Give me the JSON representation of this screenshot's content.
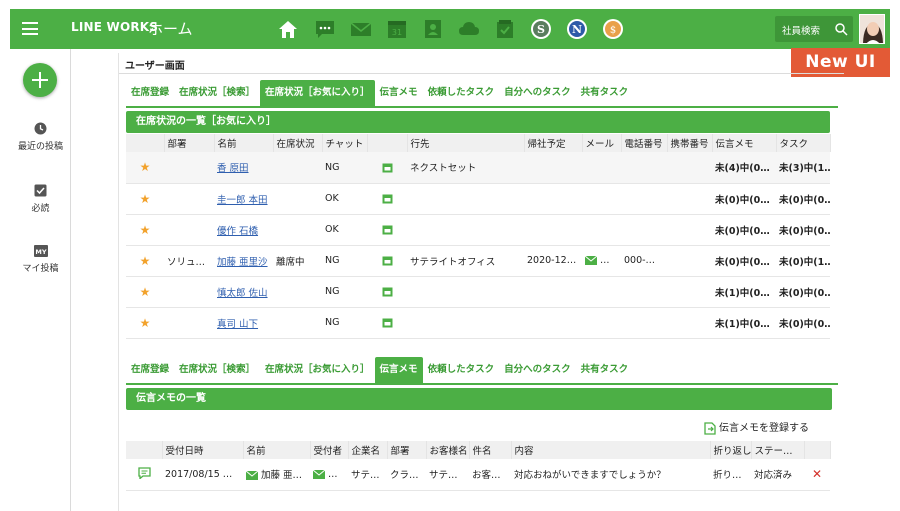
{
  "header": {
    "brand": "LINE WORKS",
    "title": "ホーム",
    "calendar_day": "31",
    "search_label": "社員検索",
    "services": [
      "home-icon",
      "chat-icon",
      "mail-icon",
      "calendar-icon",
      "contacts-icon",
      "drive-icon",
      "task-icon",
      "app-s-icon",
      "app-n-icon",
      "app-s2-icon"
    ],
    "color": "#4caf45"
  },
  "badge": {
    "label": "New UI",
    "color": "#e35a36"
  },
  "sidebar": {
    "items": [
      {
        "label": "最近の投稿",
        "icon": "clock-icon"
      },
      {
        "label": "必読",
        "icon": "check-square-icon"
      },
      {
        "label": "マイ投稿",
        "icon": "my-posts-icon",
        "icon_text": "MY"
      }
    ]
  },
  "panel": {
    "title": "ユーザー画面"
  },
  "tabs_top": [
    "在席登録",
    "在席状況［検索］",
    "在席状況［お気に入り］",
    "伝言メモ",
    "依頼したタスク",
    "自分へのタスク",
    "共有タスク"
  ],
  "tabs_bottom": [
    "在席登録",
    "在席状況［検索］",
    "在席状況［お気に入り］",
    "伝言メモ",
    "依頼したタスク",
    "自分へのタスク",
    "共有タスク"
  ],
  "attendance": {
    "section_title": "在席状況の一覧［お気に入り］",
    "columns": [
      "部署",
      "名前",
      "在席状況",
      "チャット",
      "",
      "行先",
      "帰社予定",
      "メール",
      "電話番号",
      "携帯番号",
      "伝言メモ",
      "タスク"
    ],
    "rows": [
      {
        "dept": "",
        "name": "香 原田",
        "status": "",
        "chat": "NG",
        "dest": "ネクストセット",
        "return": "",
        "mail": "",
        "phone": "",
        "mobile": "",
        "memo": "未(4)中(0…",
        "task": "未(3)中(1…"
      },
      {
        "dept": "",
        "name": "圭一郎 本田",
        "status": "",
        "chat": "OK",
        "dest": "",
        "return": "",
        "mail": "",
        "phone": "",
        "mobile": "",
        "memo": "未(0)中(0…",
        "task": "未(0)中(0…"
      },
      {
        "dept": "",
        "name": "優作 石橋",
        "status": "",
        "chat": "OK",
        "dest": "",
        "return": "",
        "mail": "",
        "phone": "",
        "mobile": "",
        "memo": "未(0)中(0…",
        "task": "未(0)中(0…"
      },
      {
        "dept": "ソリュ…",
        "name": "加藤 亜里沙",
        "status": "離席中",
        "chat": "NG",
        "dest": "サテライトオフィス",
        "return": "2020-12…",
        "mail": "…",
        "phone": "000-…",
        "mobile": "",
        "memo": "未(0)中(0…",
        "task": "未(0)中(1…"
      },
      {
        "dept": "",
        "name": "慎太郎 佐山",
        "status": "",
        "chat": "NG",
        "dest": "",
        "return": "",
        "mail": "",
        "phone": "",
        "mobile": "",
        "memo": "未(1)中(0…",
        "task": "未(0)中(0…"
      },
      {
        "dept": "",
        "name": "真司 山下",
        "status": "",
        "chat": "NG",
        "dest": "",
        "return": "",
        "mail": "",
        "phone": "",
        "mobile": "",
        "memo": "未(1)中(0…",
        "task": "未(0)中(0…"
      }
    ]
  },
  "memo": {
    "section_title": "伝言メモの一覧",
    "register_label": "伝言メモを登録する",
    "columns": [
      "",
      "受付日時",
      "名前",
      "受付者",
      "企業名",
      "部署",
      "お客様名",
      "件名",
      "内容",
      "折り返し",
      "ステー…",
      ""
    ],
    "rows": [
      {
        "date": "2017/08/15 …",
        "name": "加藤 亜…",
        "receiver": "…",
        "company": "サテ…",
        "dept": "クラ…",
        "customer": "サテ…",
        "subject": "お客…",
        "content": "対応おねがいできますでしょうか？",
        "callback": "折り…",
        "status": "対応済み"
      }
    ]
  }
}
